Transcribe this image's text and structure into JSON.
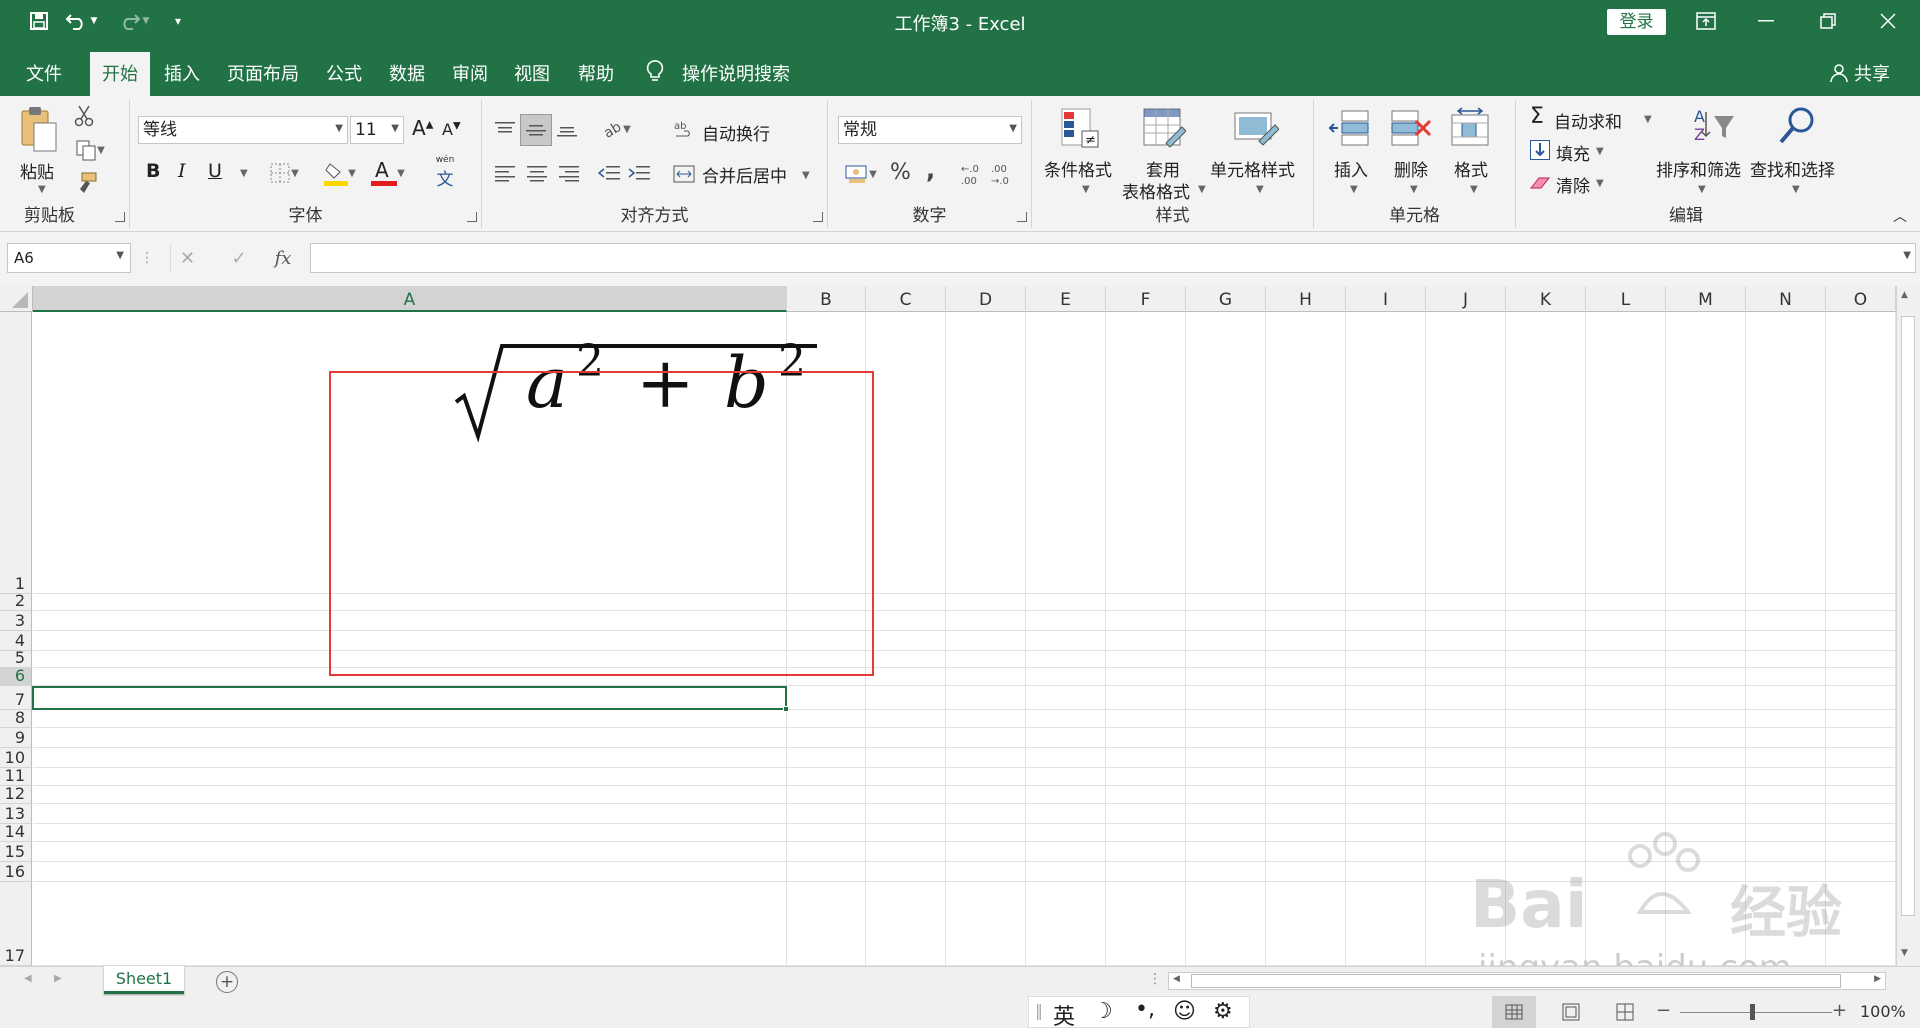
{
  "titlebar": {
    "title": "工作簿3  -  Excel",
    "login": "登录",
    "save_icon": "save-icon",
    "undo_icon": "undo-icon",
    "redo_icon": "redo-icon"
  },
  "menu": {
    "tabs": [
      "文件",
      "开始",
      "插入",
      "页面布局",
      "公式",
      "数据",
      "审阅",
      "视图",
      "帮助"
    ],
    "active": "开始",
    "search": "操作说明搜索",
    "share": "共享"
  },
  "ribbon": {
    "clipboard": {
      "paste": "粘贴",
      "label": "剪贴板"
    },
    "font": {
      "name": "等线",
      "size": "11",
      "bold": "B",
      "italic": "I",
      "underline": "U",
      "label": "字体",
      "increase": "A",
      "decrease": "A",
      "phonetic_top": "wén",
      "phonetic": "文"
    },
    "alignment": {
      "wrap": "自动换行",
      "merge": "合并后居中",
      "label": "对齐方式"
    },
    "number": {
      "format": "常规",
      "percent": "%",
      "comma": ",",
      "label": "数字"
    },
    "styles": {
      "conditional": "条件格式",
      "table_line1": "套用",
      "table_line2": "表格格式",
      "cell_styles": "单元格样式",
      "label": "样式"
    },
    "cells": {
      "insert": "插入",
      "delete": "删除",
      "format": "格式",
      "label": "单元格"
    },
    "editing": {
      "autosum": "自动求和",
      "fill": "填充",
      "clear": "清除",
      "sort": "排序和筛选",
      "find": "查找和选择",
      "label": "编辑"
    }
  },
  "formulabar": {
    "namebox": "A6",
    "fx": "fx"
  },
  "grid": {
    "columns": [
      "A",
      "B",
      "C",
      "D",
      "E",
      "F",
      "G",
      "H",
      "I",
      "J",
      "K",
      "L",
      "M",
      "N",
      "O"
    ],
    "rows": [
      "1",
      "2",
      "3",
      "4",
      "5",
      "6",
      "7",
      "8",
      "9",
      "10",
      "11",
      "12",
      "13",
      "14",
      "15",
      "16",
      "17"
    ],
    "selected_cell": "A6",
    "equation": {
      "radicand_a": "a",
      "exp1": "2",
      "plus": "+",
      "radicand_b": "b",
      "exp2": "2"
    }
  },
  "sheets": {
    "tabs": [
      "Sheet1"
    ]
  },
  "status": {
    "ime": "英",
    "zoom": "100%",
    "watermark_line1": "Bai",
    "watermark_line2": "经验",
    "watermark_url": "jingyan.baidu.com"
  },
  "colors": {
    "excel_green": "#217346",
    "highlight_red": "#e53935"
  }
}
